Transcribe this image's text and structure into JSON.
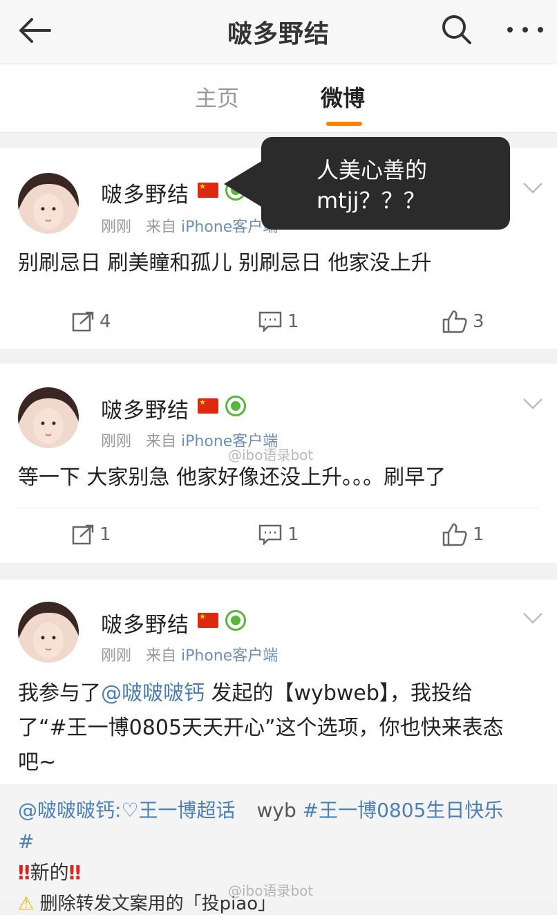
{
  "header": {
    "title": "啵多野结",
    "back_icon": "back-arrow-icon",
    "search_icon": "search-icon",
    "more_icon": "more-dots-icon"
  },
  "tabs": [
    {
      "label": "主页",
      "active": false
    },
    {
      "label": "微博",
      "active": true
    }
  ],
  "tooltip": {
    "line1": "人美心善的",
    "line2": "mtjj？？？"
  },
  "posts": [
    {
      "author": "啵多野结",
      "time": "刚刚",
      "source_prefix": "来自",
      "source": "iPhone客户端",
      "text": "别刷忌日 刷美瞳和孤儿 别刷忌日 他家没上升",
      "reposts": "4",
      "comments": "1",
      "likes": "3"
    },
    {
      "author": "啵多野结",
      "time": "刚刚",
      "source_prefix": "来自",
      "source": "iPhone客户端",
      "text": "等一下 大家别急 他家好像还没上升。。。刷早了",
      "reposts": "1",
      "comments": "1",
      "likes": "1"
    },
    {
      "author": "啵多野结",
      "time": "刚刚",
      "source_prefix": "来自",
      "source": "iPhone客户端",
      "text_prefix": "我参与了",
      "text_mention": "@啵啵啵钙",
      "text_suffix_line1": " 发起的【wybweb】，我投给",
      "text_line2": "了“#王一博0805天天开心”这个选项，你也快来表态",
      "text_line3": "吧~"
    }
  ],
  "repost": {
    "mention": "@啵啵啵钙",
    "super_topic": ":♡王一博超话",
    "plain": "wyb",
    "hashtag": "#王一博0805生日快乐",
    "hashtag_end": "#",
    "new_label": "新的",
    "bang": "‼",
    "line4": "删除转发文案用的「投piao」"
  },
  "watermarks": [
    "@ibo语录bot",
    "@ibo语录bot"
  ],
  "colors": {
    "accent": "#ff8200",
    "link": "#4a7fb8",
    "verified": "#58b73a"
  }
}
